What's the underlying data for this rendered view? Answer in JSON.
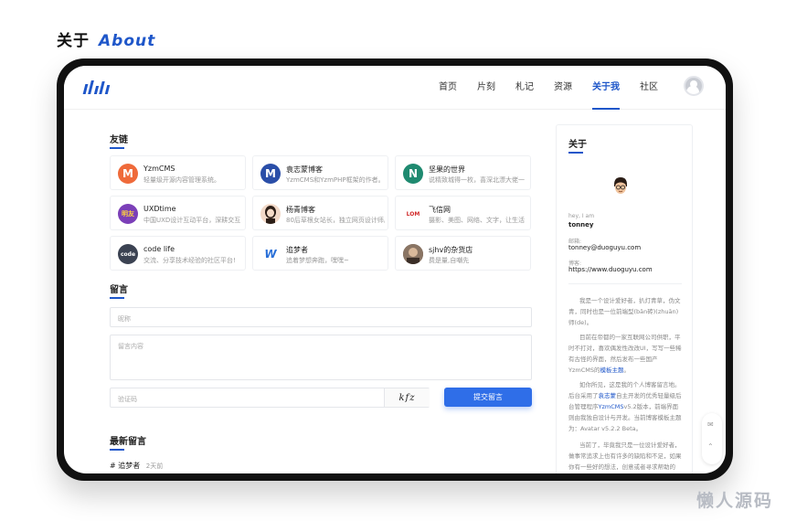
{
  "heading": {
    "zh": "关于",
    "en": "About"
  },
  "nav": {
    "items": [
      {
        "label": "首页",
        "active": false
      },
      {
        "label": "片刻",
        "active": false
      },
      {
        "label": "札记",
        "active": false
      },
      {
        "label": "资源",
        "active": false
      },
      {
        "label": "关于我",
        "active": true
      },
      {
        "label": "社区",
        "active": false
      }
    ]
  },
  "links": {
    "title": "友链",
    "items": [
      {
        "name": "YzmCMS",
        "desc": "轻量级开源内容管理系统。",
        "icon": "M",
        "color": "#ef6a3a"
      },
      {
        "name": "袁志蒙博客",
        "desc": "YzmCMS和YzmPHP框架的作者。",
        "icon": "M",
        "color": "#2a4ea8"
      },
      {
        "name": "坚果的世界",
        "desc": "说精致城得一枚，喜深北漂大佬一",
        "icon": "N",
        "color": "#1f8a70"
      },
      {
        "name": "UXDtime",
        "desc": "中国UXD设计互动平台，深耕交互",
        "icon": "明友",
        "color": "#7b3fb8"
      },
      {
        "name": "杨青博客",
        "desc": "80后草根女站长，独立网页设计师。",
        "icon": "",
        "color": "#f2d9c8"
      },
      {
        "name": "飞信网",
        "desc": "摄影、美图、网络、文字，让生活",
        "icon": "LOM",
        "color": "#ffffff"
      },
      {
        "name": "code life",
        "desc": "交流、分享技术经验的社区平台!",
        "icon": "code",
        "color": "#3b4252"
      },
      {
        "name": "追梦者",
        "desc": "追着梦想奔跑，嘿嘿~",
        "icon": "W",
        "color": "#ffffff"
      },
      {
        "name": "sjhv的杂货店",
        "desc": "费是量,自嘲先",
        "icon": "",
        "color": "#6b5a4e"
      }
    ]
  },
  "comment_form": {
    "title": "留言",
    "nickname_placeholder": "昵称",
    "content_placeholder": "留言内容",
    "captcha_placeholder": "验证码",
    "captcha_text": "kfz",
    "submit_label": "提交留言"
  },
  "latest": {
    "title": "最新留言",
    "entry_prefix": "#",
    "entry_name": "追梦者",
    "entry_time": "2天前"
  },
  "sidebar": {
    "title": "关于",
    "greeting": "hey, I am",
    "name": "tonney",
    "email_label": "邮箱:",
    "email": "tonney@duoguyu.com",
    "blog_label": "博客:",
    "blog": "https://www.duoguyu.com",
    "para1": "我是一个设计爱好者，扒灯青草，伪文青，同时也是一位前端型(bān砖)(zhuān)师(de)。",
    "para2_a": "目前在帝都的一家互联网公司供职，平时不打对，喜欢偶发性改改UI，写写一些稀有古怪的界面，然后发布一些国产YzmCMS的",
    "para2_hl": "模板主题",
    "para2_b": "。",
    "para3_a": "如你所见，这是我的个人博客留言地。后台采用了",
    "para3_hl1": "袁志蒙",
    "para3_b": "自主开发的优秀轻量级后台管理程序",
    "para3_hl2": "YzmCMS",
    "para3_c": "v5.2版本，前端界面则由我独自设计与开发。当前博客模板主题为：Avatar v5.2.2 Beta。",
    "para4": "当前了，毕竟我只是一位设计爱好者，做事常追求上也有许多的缺陷和不足，如果你有一些好的想法，创意或者寻求帮助的话，可以发邮件或我"
  },
  "watermark": "懒人源码"
}
